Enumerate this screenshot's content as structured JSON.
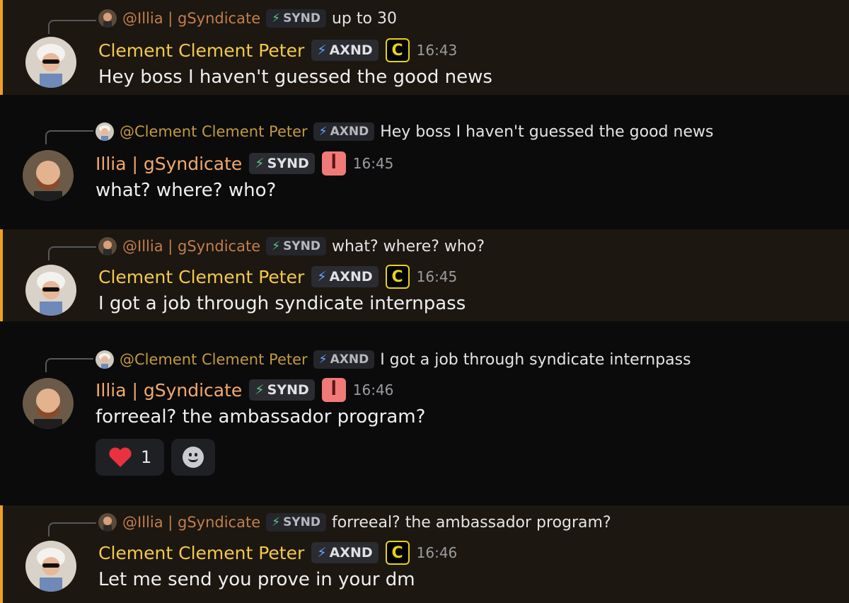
{
  "messages": [
    {
      "reply": {
        "author": "@Illia | gSyndicate",
        "tag": "SYND",
        "text": "up to 30"
      },
      "author": "Clement Clement Peter",
      "tag": "AXND",
      "role_icon": "C",
      "time": "16:43",
      "text": "Hey boss I haven't guessed the good news"
    },
    {
      "reply": {
        "author": "@Clement Clement Peter",
        "tag": "AXND",
        "text": "Hey boss I haven't guessed the good news"
      },
      "author": "Illia | gSyndicate",
      "tag": "SYND",
      "role_icon": "ꟾ",
      "time": "16:45",
      "text": "what? where? who?"
    },
    {
      "reply": {
        "author": "@Illia | gSyndicate",
        "tag": "SYND",
        "text": "what? where? who?"
      },
      "author": "Clement Clement Peter",
      "tag": "AXND",
      "role_icon": "C",
      "time": "16:45",
      "text": "I got a job through syndicate internpass"
    },
    {
      "reply": {
        "author": "@Clement Clement Peter",
        "tag": "AXND",
        "text": "I got a job through syndicate internpass"
      },
      "author": "Illia | gSyndicate",
      "tag": "SYND",
      "role_icon": "ꟾ",
      "time": "16:46",
      "text": "forreeal? the ambassador program?",
      "reaction_count": "1"
    },
    {
      "reply": {
        "author": "@Illia | gSyndicate",
        "tag": "SYND",
        "text": "forreeal? the ambassador program?"
      },
      "author": "Clement Clement Peter",
      "tag": "AXND",
      "role_icon": "C",
      "time": "16:46",
      "text": "Let me send you prove in your dm"
    }
  ],
  "colors": {
    "clement": "#f2c94c",
    "illia": "#f3a86a",
    "highlight_border": "#f0a020",
    "synd_bolt": "#5ec489",
    "axnd_bolt": "#6ba6ff"
  },
  "icons": [
    "lightning-bolt-icon",
    "heart-icon",
    "add-reaction-smiley-icon",
    "role-c-icon",
    "role-s-icon"
  ]
}
